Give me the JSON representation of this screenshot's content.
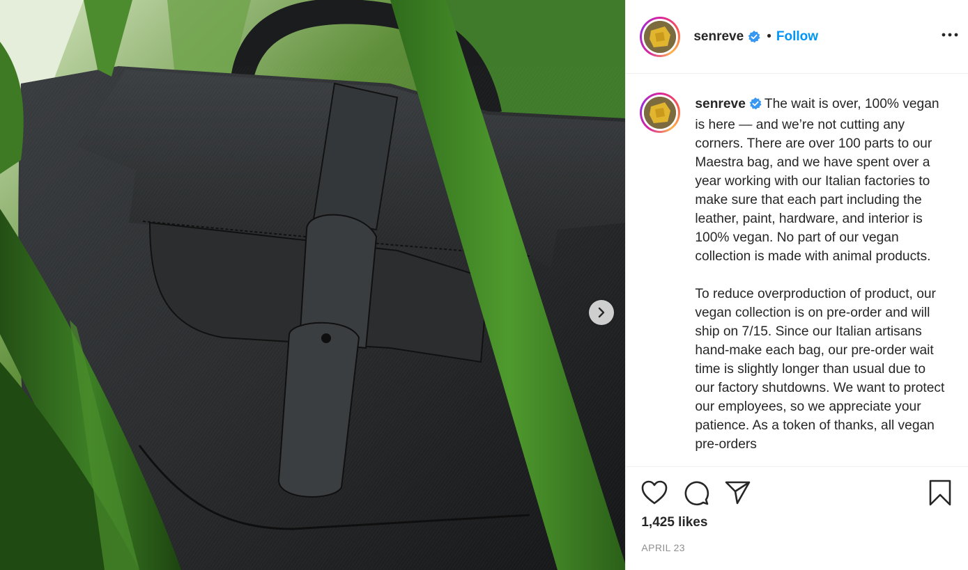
{
  "post": {
    "username": "senreve",
    "follow_label": "Follow",
    "separator": "•",
    "caption": "The wait is over, 100% vegan is here — and we’re not cutting any corners. There are over 100 parts to our Maestra bag, and we have spent over a year working with our Italian factories to make sure that each part including the leather, paint, hardware, and interior is 100% vegan. No part of our vegan collection is made with animal products.\n\nTo reduce overproduction of product, our vegan collection is on pre-order and will ship on 7/15. Since our Italian artisans hand-make each bag, our pre-order wait time is slightly longer than usual due to our factory shutdowns. We want to protect our employees, so we appreciate your patience. As a token of thanks, all vegan pre-orders",
    "likes": "1,425 likes",
    "date": "APRIL 23"
  },
  "icons": {
    "verified": "verified-badge-icon",
    "more": "more-options-icon",
    "next": "chevron-right-icon",
    "like": "heart-icon",
    "comment": "comment-icon",
    "share": "paper-plane-icon",
    "save": "bookmark-icon"
  },
  "colors": {
    "accent": "#0095f6",
    "verified": "#3897f0",
    "text": "#262626",
    "muted": "#8e8e8e"
  }
}
